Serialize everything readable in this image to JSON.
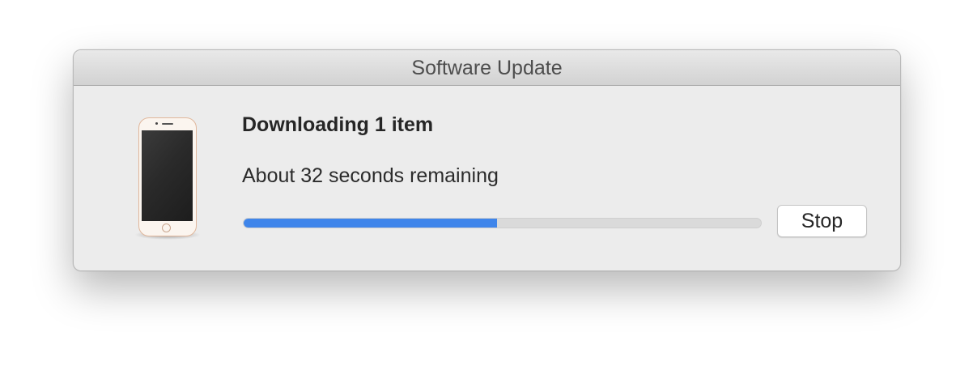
{
  "window": {
    "title": "Software Update"
  },
  "device": {
    "icon": "iphone-device-icon"
  },
  "download": {
    "heading": "Downloading 1 item",
    "status": "About 32 seconds remaining",
    "progress_fraction": 0.49
  },
  "buttons": {
    "stop_label": "Stop"
  },
  "colors": {
    "progress_fill": "#3f85ea",
    "progress_track": "#dadada",
    "window_background": "#ececec"
  }
}
